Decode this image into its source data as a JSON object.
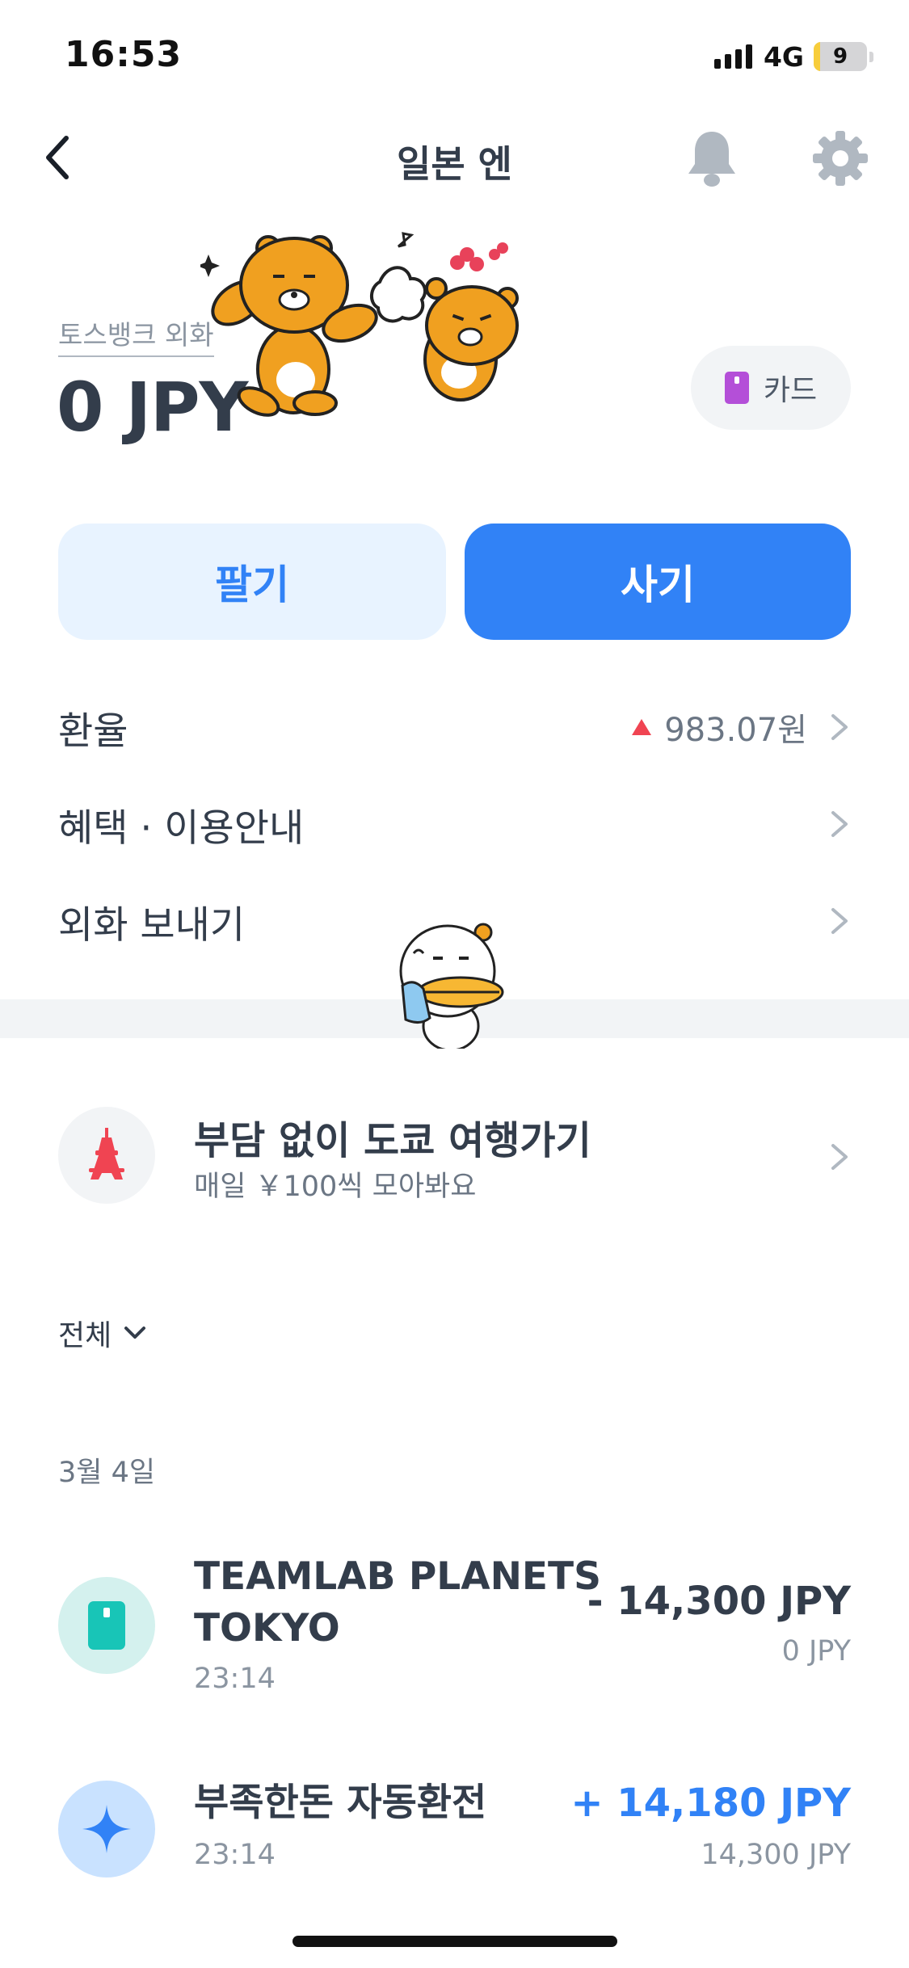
{
  "status_bar": {
    "time": "16:53",
    "network": "4G",
    "battery_level": "9",
    "battery_fraction": 0.09
  },
  "nav": {
    "title": "일본 엔",
    "back_icon": "chevron-left-icon",
    "bell_icon": "bell-icon",
    "settings_icon": "gear-icon"
  },
  "account": {
    "label_visible": "토스뱅크 외화",
    "balance": "0 JPY",
    "card_label": "카드"
  },
  "actions": {
    "sell_label": "팔기",
    "buy_label": "사기"
  },
  "menu": {
    "rate_label": "환율",
    "rate_value": "983.07원",
    "rate_trend": "up",
    "benefits_label": "혜택 · 이용안내",
    "send_label": "외화 보내기"
  },
  "promo": {
    "title": "부담 없이 도쿄 여행가기",
    "subtitle": "매일 ￥100씩 모아봐요",
    "icon": "tokyo-tower-icon"
  },
  "filter": {
    "label": "전체"
  },
  "transactions": {
    "date": "3월 4일",
    "items": [
      {
        "name": "TEAMLAB PLANETS TOKYO",
        "time": "23:14",
        "amount": "- 14,300 JPY",
        "balance": "0 JPY",
        "icon": "card-icon"
      },
      {
        "name": "부족한돈 자동환전",
        "time": "23:14",
        "amount": "+ 14,180 JPY",
        "balance": "14,300 JPY",
        "icon": "sparkle-icon"
      }
    ]
  },
  "colors": {
    "primary": "#3182f6",
    "primary_light": "#e8f3ff",
    "text_main": "#333d4b",
    "text_sub": "#6b7684",
    "rate_up": "#f04452",
    "divider": "#f2f4f6"
  }
}
